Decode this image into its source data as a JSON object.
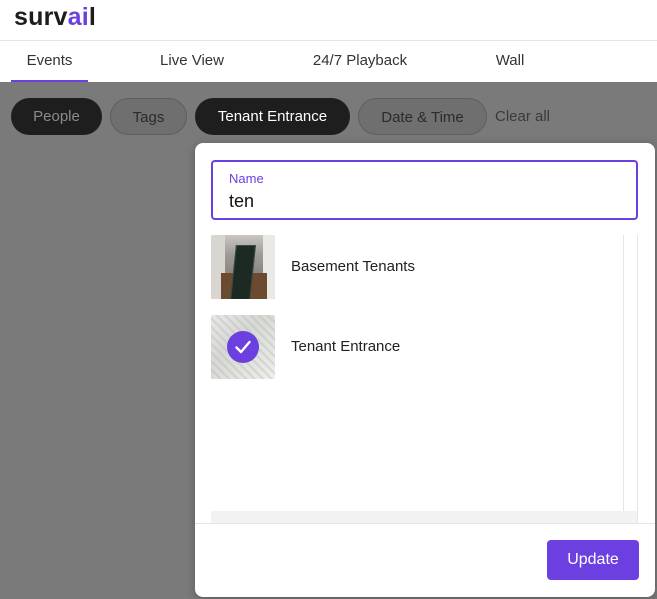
{
  "brand": {
    "name_prefix": "surv",
    "name_accent": "ai",
    "name_suffix": "l",
    "accent_color": "#6b3fe0"
  },
  "tabs": [
    {
      "label": "Events",
      "active": true
    },
    {
      "label": "Live View",
      "active": false
    },
    {
      "label": "24/7 Playback",
      "active": false
    },
    {
      "label": "Wall",
      "active": false
    }
  ],
  "filters": {
    "chips": [
      {
        "label": "People",
        "style": "dark-dim"
      },
      {
        "label": "Tags",
        "style": "outline"
      },
      {
        "label": "Tenant Entrance",
        "style": "dark"
      },
      {
        "label": "Date & Time",
        "style": "outline"
      }
    ],
    "clear_label": "Clear all"
  },
  "popover": {
    "name_label": "Name",
    "name_value": "ten",
    "results": [
      {
        "label": "Basement Tenants",
        "thumbnail_icon": "camera-thumbnail-basement",
        "selected": false
      },
      {
        "label": "Tenant Entrance",
        "thumbnail_icon": "camera-thumbnail-entrance",
        "selected": true
      }
    ],
    "update_label": "Update"
  }
}
